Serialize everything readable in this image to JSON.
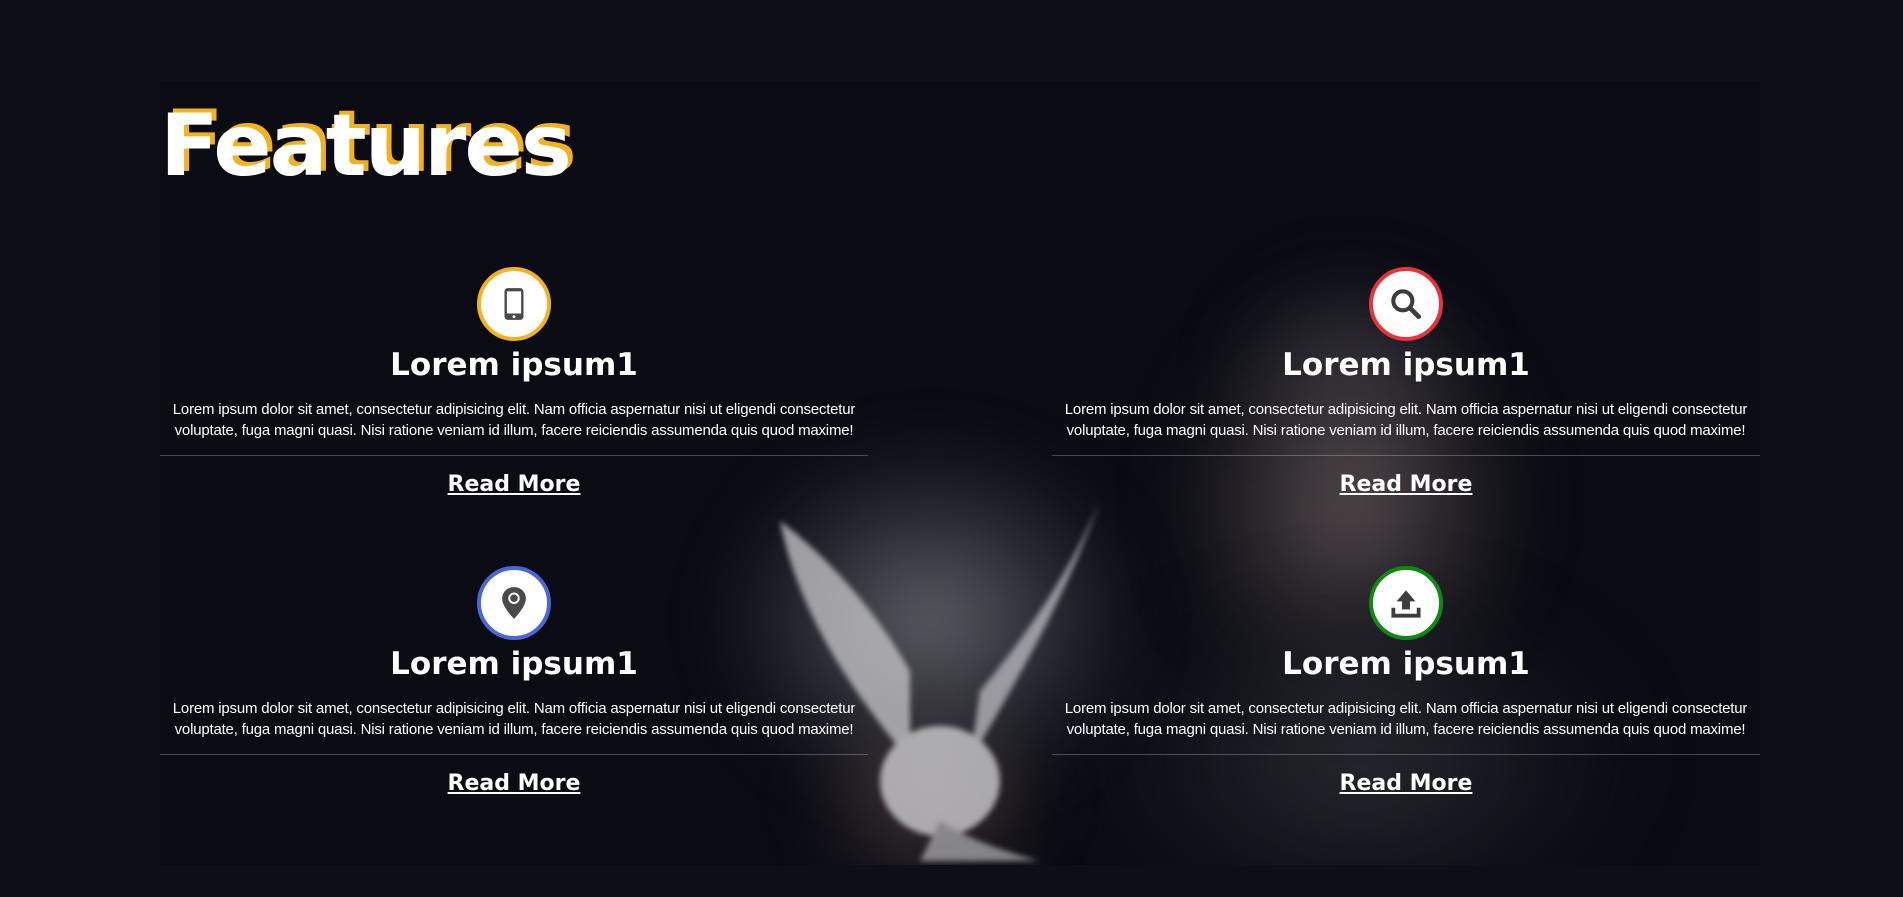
{
  "section": {
    "title": "Features",
    "colors": {
      "background": "#0d0e18",
      "title_shadow": "#f2b21b"
    }
  },
  "features": [
    {
      "icon": "tablet-icon",
      "ring_color": "#f2b21b",
      "heading": "Lorem ipsum1",
      "body": "Lorem ipsum dolor sit amet, consectetur adipisicing elit. Nam officia aspernatur nisi ut eligendi consectetur voluptate, fuga magni quasi. Nisi ratione veniam id illum, facere reiciendis assumenda quis quod maxime!",
      "link": "Read More"
    },
    {
      "icon": "search-icon",
      "ring_color": "#e8323c",
      "heading": "Lorem ipsum1",
      "body": "Lorem ipsum dolor sit amet, consectetur adipisicing elit. Nam officia aspernatur nisi ut eligendi consectetur voluptate, fuga magni quasi. Nisi ratione veniam id illum, facere reiciendis assumenda quis quod maxime!",
      "link": "Read More"
    },
    {
      "icon": "location-pin-icon",
      "ring_color": "#4a66d9",
      "heading": "Lorem ipsum1",
      "body": "Lorem ipsum dolor sit amet, consectetur adipisicing elit. Nam officia aspernatur nisi ut eligendi consectetur voluptate, fuga magni quasi. Nisi ratione veniam id illum, facere reiciendis assumenda quis quod maxime!",
      "link": "Read More"
    },
    {
      "icon": "upload-icon",
      "ring_color": "#0e8a12",
      "heading": "Lorem ipsum1",
      "body": "Lorem ipsum dolor sit amet, consectetur adipisicing elit. Nam officia aspernatur nisi ut eligendi consectetur voluptate, fuga magni quasi. Nisi ratione veniam id illum, facere reiciendis assumenda quis quod maxime!",
      "link": "Read More"
    }
  ]
}
